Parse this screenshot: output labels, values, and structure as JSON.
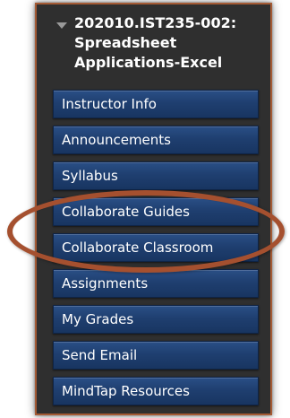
{
  "course": {
    "title": "202010.IST235-002: Spreadsheet Applications-Excel"
  },
  "menu": {
    "items": [
      {
        "label": "Instructor Info"
      },
      {
        "label": "Announcements"
      },
      {
        "label": "Syllabus"
      },
      {
        "label": "Collaborate Guides"
      },
      {
        "label": "Collaborate Classroom"
      },
      {
        "label": "Assignments"
      },
      {
        "label": "My Grades"
      },
      {
        "label": "Send Email"
      },
      {
        "label": "MindTap Resources"
      }
    ]
  },
  "colors": {
    "panel_bg": "#2f2f2f",
    "panel_border": "#a45a34",
    "button_blue": "#1f3f70",
    "highlight_ellipse": "#a5502f"
  }
}
